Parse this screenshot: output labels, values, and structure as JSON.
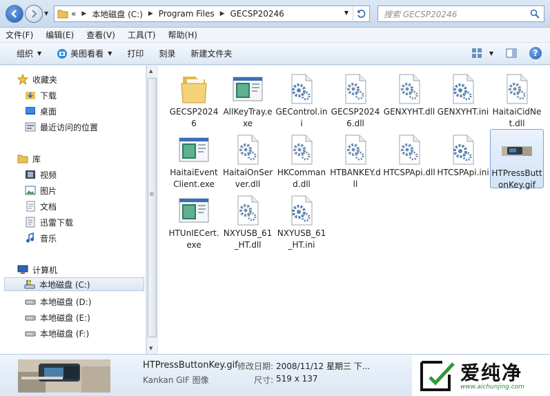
{
  "address": {
    "crumbs": [
      "«",
      "本地磁盘 (C:)",
      "Program Files",
      "GECSP20246"
    ],
    "search_placeholder": "搜索 GECSP20246"
  },
  "menu": [
    "文件(F)",
    "编辑(E)",
    "查看(V)",
    "工具(T)",
    "帮助(H)"
  ],
  "command_bar": {
    "organize": "组织",
    "view_pictures": "美图看看",
    "print": "打印",
    "burn": "刻录",
    "new_folder": "新建文件夹"
  },
  "nav": {
    "favorites": "收藏夹",
    "downloads": "下载",
    "desktop": "桌面",
    "recent": "最近访问的位置",
    "libraries": "库",
    "videos": "视频",
    "pictures": "图片",
    "documents": "文档",
    "thunder": "迅雷下载",
    "music": "音乐",
    "computer": "计算机",
    "drive_c": "本地磁盘 (C:)",
    "drive_d": "本地磁盘 (D:)",
    "drive_e": "本地磁盘 (E:)",
    "drive_f": "本地磁盘 (F:)"
  },
  "files": [
    {
      "name": "GECSP20246",
      "type": "folder"
    },
    {
      "name": "AllKeyTray.exe",
      "type": "exe"
    },
    {
      "name": "GEControl.ini",
      "type": "ini"
    },
    {
      "name": "GECSP20246.dll",
      "type": "dll"
    },
    {
      "name": "GENXYHT.dll",
      "type": "dll"
    },
    {
      "name": "GENXYHT.ini",
      "type": "ini"
    },
    {
      "name": "HaitaiCidNet.dll",
      "type": "dll"
    },
    {
      "name": "HaitaiEventClient.exe",
      "type": "exe"
    },
    {
      "name": "HaitaiOnServer.dll",
      "type": "dll"
    },
    {
      "name": "HKCommand.dll",
      "type": "dll"
    },
    {
      "name": "HTBANKEY.dll",
      "type": "dll"
    },
    {
      "name": "HTCSPApi.dll",
      "type": "dll"
    },
    {
      "name": "HTCSPApi.ini",
      "type": "ini"
    },
    {
      "name": "HTPressButtonKey.gif",
      "type": "gif"
    },
    {
      "name": "HTUnIECert.exe",
      "type": "exe"
    },
    {
      "name": "NXYUSB_61_HT.dll",
      "type": "dll"
    },
    {
      "name": "NXYUSB_61_HT.ini",
      "type": "ini"
    }
  ],
  "details": {
    "name": "HTPressButtonKey.gif",
    "type": "Kankan GIF 图像",
    "modified_label": "修改日期:",
    "modified_value": "2008/11/12 星期三 下...",
    "size_label": "尺寸:",
    "size_value": "519 x 137"
  },
  "watermark": {
    "text": "爱纯净",
    "url": "www.aichunjing.com"
  }
}
